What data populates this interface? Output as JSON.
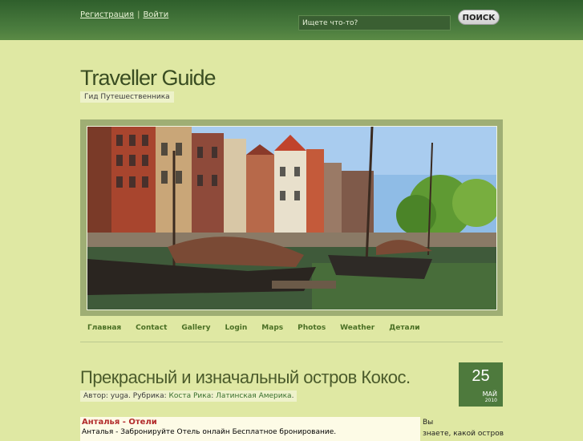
{
  "header": {
    "register": "Регистрация",
    "separator": "|",
    "login": "Войти",
    "search_placeholder": "Ищете что-то?",
    "search_button": "ПОИСК"
  },
  "site": {
    "title": "Traveller Guide",
    "tagline": "Гид Путешественника"
  },
  "nav": [
    "Главная",
    "Contact",
    "Gallery",
    "Login",
    "Maps",
    "Photos",
    "Weather",
    "Детали"
  ],
  "post": {
    "title": "Прекрасный и изначальный остров Кокос.",
    "meta_prefix": "Автор: yuga. Рубрика:",
    "category_1": "Коста Рика",
    "category_2": "Латинская Америка",
    "date_day": "25",
    "date_month": "МАЙ",
    "date_year": "2010"
  },
  "ad": {
    "title": "Анталья - Отели",
    "text": "Анталья - Забронируйте Отель онлайн Бесплатное бронирование."
  },
  "sidebar": {
    "line1": "Вы",
    "line2": "знаете, какой остров"
  },
  "colors": {
    "header_green": "#4a7c3e",
    "page_bg": "#dfe8a3",
    "nav_text": "#4a6f24",
    "date_box": "#4e7a3d",
    "ad_title": "#b22b2b"
  }
}
